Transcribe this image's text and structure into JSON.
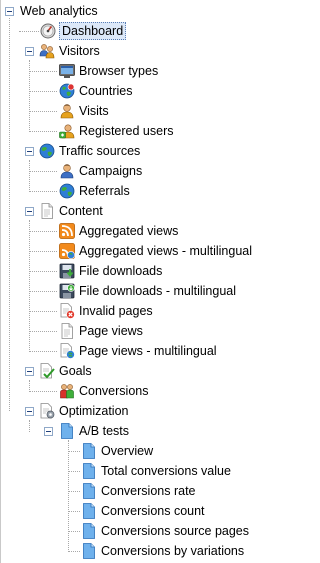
{
  "tree": {
    "root": {
      "label": "Web analytics"
    },
    "dashboard": {
      "label": "Dashboard",
      "icon": "dashboard-gauge-icon"
    },
    "visitors": {
      "label": "Visitors",
      "icon": "visitors-icon",
      "children": {
        "browser_types": {
          "label": "Browser types",
          "icon": "browser-icon"
        },
        "countries": {
          "label": "Countries",
          "icon": "globe-icon"
        },
        "visits": {
          "label": "Visits",
          "icon": "user-icon"
        },
        "registered_users": {
          "label": "Registered users",
          "icon": "user-add-icon"
        }
      }
    },
    "traffic_sources": {
      "label": "Traffic sources",
      "icon": "globe-icon",
      "children": {
        "campaigns": {
          "label": "Campaigns",
          "icon": "user-icon"
        },
        "referrals": {
          "label": "Referrals",
          "icon": "globe-icon"
        }
      }
    },
    "content": {
      "label": "Content",
      "icon": "document-icon",
      "children": {
        "aggregated_views": {
          "label": "Aggregated views",
          "icon": "rss-icon"
        },
        "aggregated_views_ml": {
          "label": "Aggregated views - multilingual",
          "icon": "rss-multilingual-icon"
        },
        "file_downloads": {
          "label": "File downloads",
          "icon": "file-download-icon"
        },
        "file_downloads_ml": {
          "label": "File downloads - multilingual",
          "icon": "file-download-multilingual-icon"
        },
        "invalid_pages": {
          "label": "Invalid pages",
          "icon": "invalid-page-icon"
        },
        "page_views": {
          "label": "Page views",
          "icon": "page-icon"
        },
        "page_views_ml": {
          "label": "Page views - multilingual",
          "icon": "page-multilingual-icon"
        }
      }
    },
    "goals": {
      "label": "Goals",
      "icon": "goals-check-icon",
      "children": {
        "conversions": {
          "label": "Conversions",
          "icon": "conversions-people-icon"
        }
      }
    },
    "optimization": {
      "label": "Optimization",
      "icon": "optimization-page-icon",
      "children": {
        "ab_tests": {
          "label": "A/B tests",
          "icon": "page-blue-icon",
          "children": {
            "overview": {
              "label": "Overview"
            },
            "total_conversions_value": {
              "label": "Total conversions value"
            },
            "conversions_rate": {
              "label": "Conversions rate"
            },
            "conversions_count": {
              "label": "Conversions count"
            },
            "conversions_source_pages": {
              "label": "Conversions source pages"
            },
            "conversions_by_variations": {
              "label": "Conversions by variations"
            }
          }
        }
      }
    }
  },
  "colors": {
    "selection_bg": "#dce8f8",
    "selection_border": "#5a7fb5",
    "tree_lines": "#a8a8a8",
    "toggle_border": "#8fa8c8"
  }
}
